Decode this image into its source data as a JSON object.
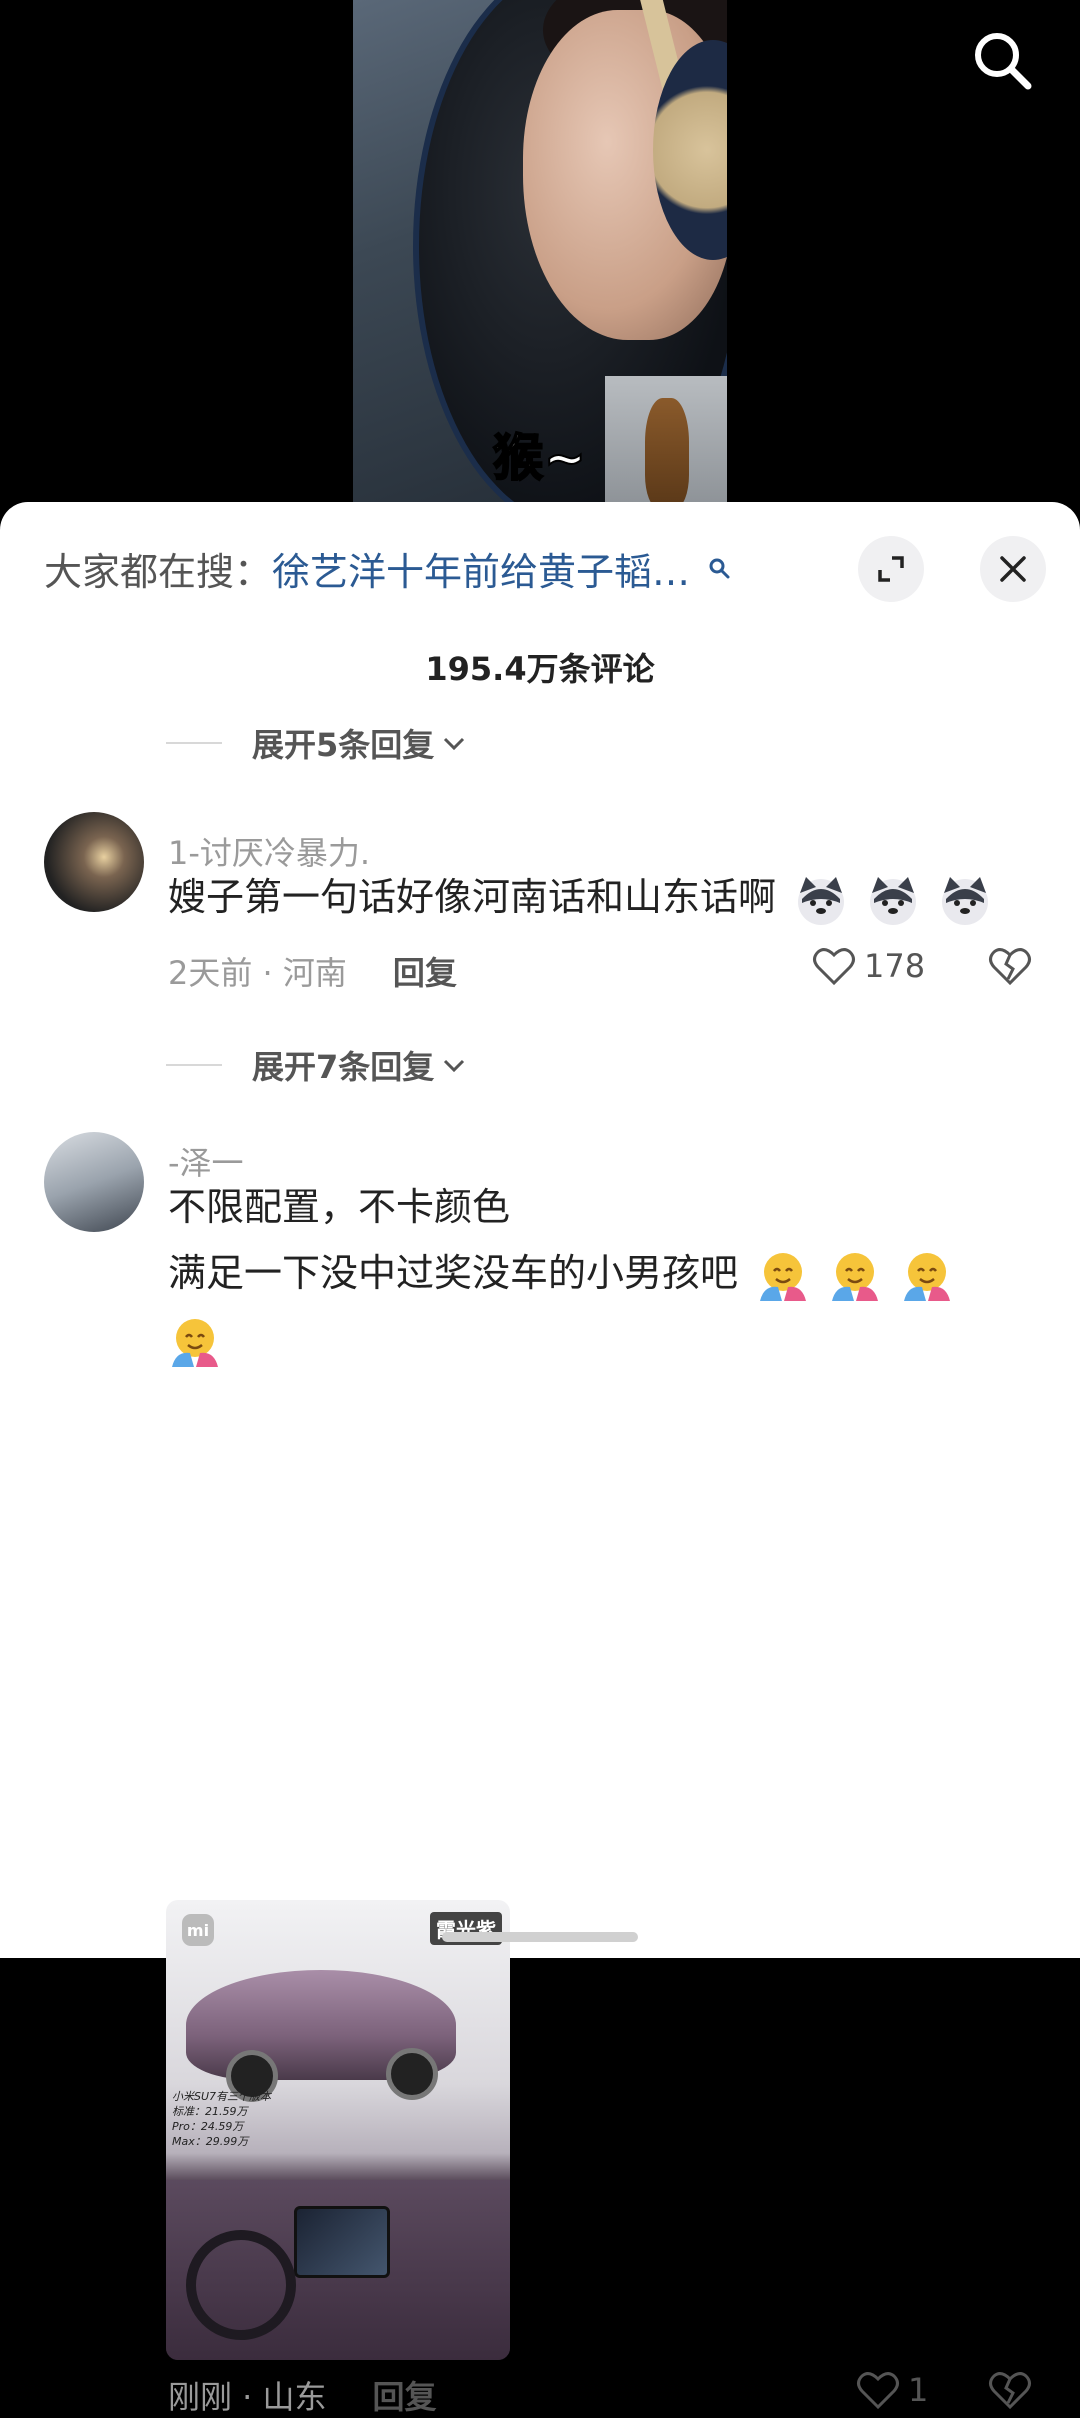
{
  "video": {
    "subtitle": "猴~",
    "search_icon": "search-icon"
  },
  "sheet": {
    "hot_search_prefix": "大家都在搜：",
    "hot_search_query": "徐艺洋十年前给黄子韬…",
    "expand_icon": "expand-icon",
    "close_icon": "close-icon",
    "comment_count": "195.4万条评论"
  },
  "expand_top": {
    "label": "展开5条回复"
  },
  "expand_mid": {
    "label": "展开7条回复"
  },
  "comments": [
    {
      "username": "1-讨厌冷暴力.",
      "text": "嫂子第一句话好像河南话和山东话啊",
      "emoji": "doge-emoji",
      "meta": "2天前 · 河南",
      "reply": "回复",
      "likes": "178"
    },
    {
      "username": "-泽一",
      "text_line1": "不限配置，不卡颜色",
      "text_line2": "满足一下没中过奖没车的小男孩吧",
      "emoji": "hug-emoji",
      "image": {
        "brand": "mi",
        "color_tag": "霞光紫",
        "spec_title": "小米SU7有三个版本",
        "spec_std": "标准：21.59万",
        "spec_pro": "Pro：24.59万",
        "spec_max": "Max：29.99万"
      },
      "meta": "刚刚 · 山东",
      "reply": "回复",
      "likes": "1"
    }
  ]
}
